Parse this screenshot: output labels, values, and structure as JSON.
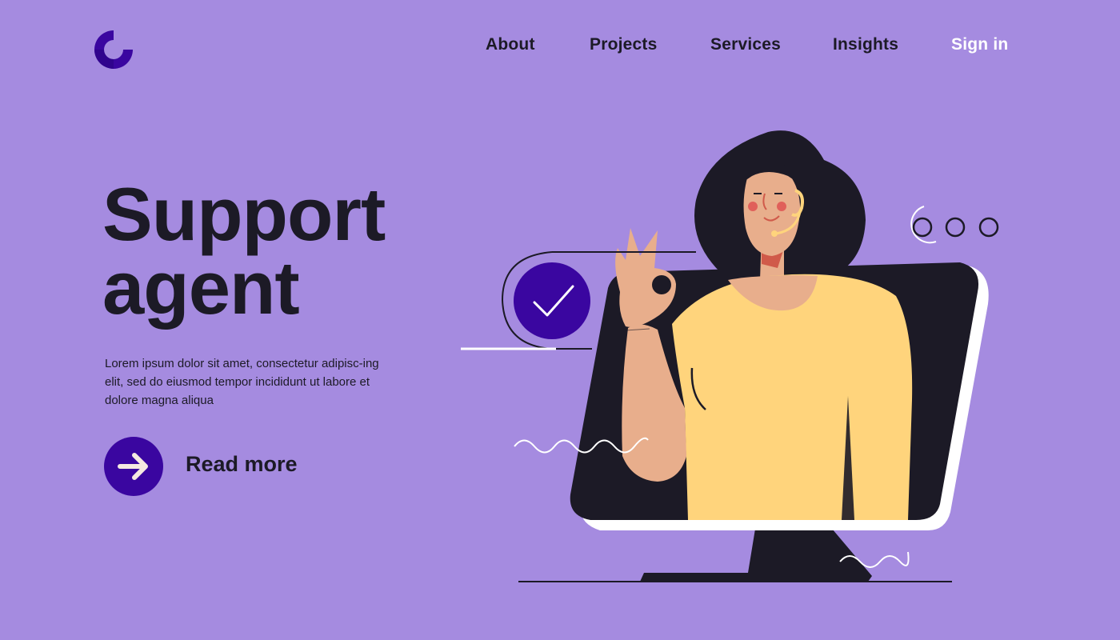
{
  "colors": {
    "background": "#a58be0",
    "accent": "#3a06a0",
    "text": "#1c1a26",
    "highlight_text": "#ffffff",
    "shirt": "#ffd47c",
    "skin": "#e8ae8c"
  },
  "logo": {
    "icon": "c-ring-logo-icon"
  },
  "nav": {
    "items": [
      {
        "label": "About"
      },
      {
        "label": "Projects"
      },
      {
        "label": "Services"
      },
      {
        "label": "Insights"
      }
    ],
    "signin_label": "Sign in"
  },
  "hero": {
    "title_line1": "Support",
    "title_line2": "agent",
    "description": "Lorem ipsum dolor sit amet, consectetur adipisc-ing elit, sed do eiusmod tempor incididunt ut labore et dolore magna aliqua",
    "cta_label": "Read more",
    "cta_icon": "arrow-right-icon"
  },
  "illustration": {
    "icons": [
      "check-icon",
      "headset-icon",
      "dots-icon",
      "wave-icon"
    ]
  }
}
